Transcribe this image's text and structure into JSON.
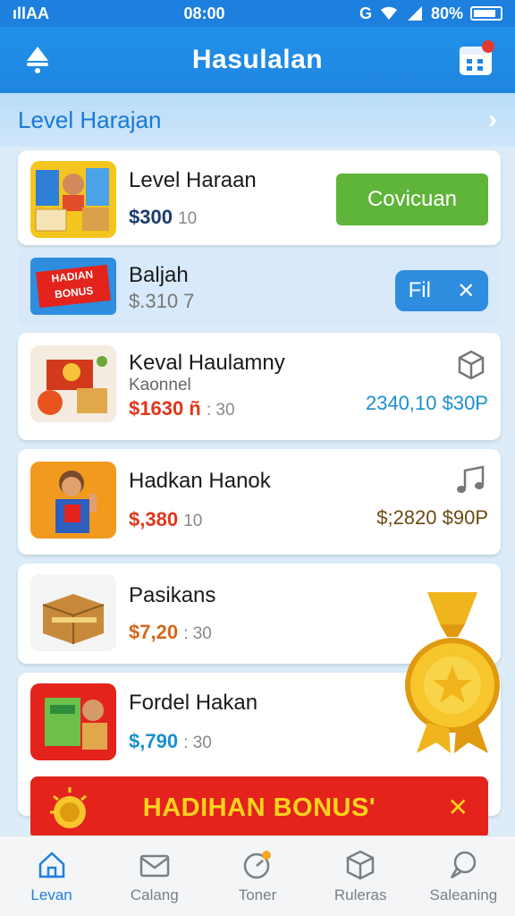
{
  "status": {
    "carrier": "ıllAA",
    "time": "08:00",
    "battery": "80%",
    "g_icon": "G"
  },
  "appbar": {
    "title": "Hasulalan",
    "left_icon": "bell-icon",
    "right_icon": "calendar-icon",
    "badge_color": "#e53935"
  },
  "section": {
    "title": "Level Harajan",
    "chevron": "›"
  },
  "items": [
    {
      "title": "Level Haraan",
      "price": "$300",
      "price_sub": "10",
      "price_color": "#1a3b6e",
      "action_label": "Covicuan",
      "action_color": "#5fb43a"
    },
    {
      "title": "Baljah",
      "price": "$.310 7",
      "price_sub": "",
      "price_color": "#777",
      "pill_label": "Fil",
      "pill_close": "✕",
      "thumb_label": "HADIAN BONUS"
    },
    {
      "title": "Keval Haulamny",
      "subtitle": "Kaonnel",
      "price": "$1630 ñ",
      "price_sub": ": 30",
      "price_color": "#e1361a",
      "right_amount": "2340,10 $30P",
      "right_amount_color": "#1a8fcf",
      "right_icon": "box-icon"
    },
    {
      "title": "Hadkan Hanok",
      "price": "$,380",
      "price_sub": "10",
      "price_color": "#e1361a",
      "right_amount": "$;2820 $90P",
      "right_amount_color": "#6b4b10",
      "right_icon": "music-icon"
    },
    {
      "title": "Pasikans",
      "price": "$7,20",
      "price_sub": ": 30",
      "price_color": "#d6661c",
      "price_prefix_color": "#2e9a3a"
    },
    {
      "title": "Fordel Hakan",
      "price": "$,790",
      "price_sub": ": 30",
      "price_color": "#1a8fcf"
    }
  ],
  "bonus": {
    "text": "HADIHAN BONUS'",
    "close": "✕"
  },
  "nav": [
    {
      "label": "Levan",
      "icon": "home-icon",
      "active": true
    },
    {
      "label": "Calang",
      "icon": "mail-icon",
      "active": false
    },
    {
      "label": "Toner",
      "icon": "gauge-icon",
      "active": false
    },
    {
      "label": "Ruleras",
      "icon": "cube-icon",
      "active": false
    },
    {
      "label": "Saleaning",
      "icon": "chat-icon",
      "active": false
    }
  ]
}
